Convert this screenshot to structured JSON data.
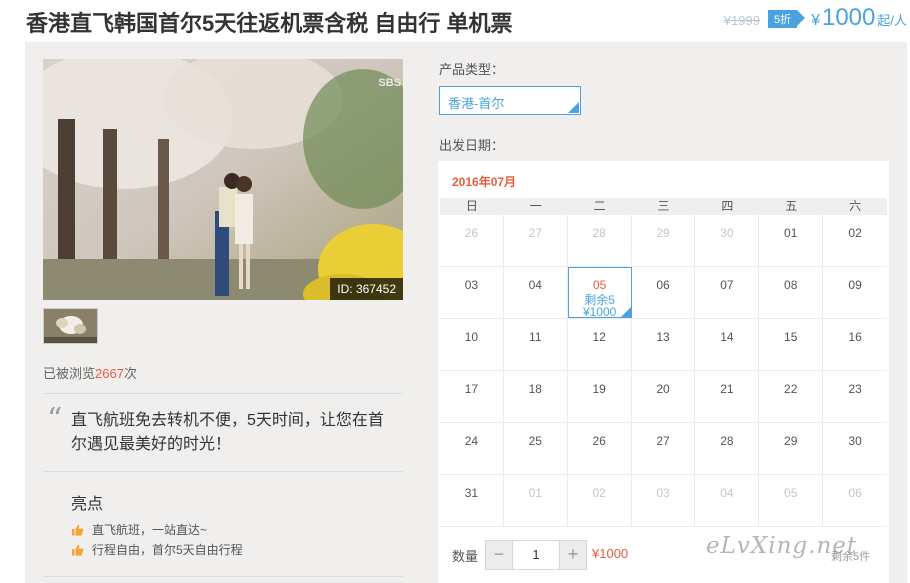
{
  "product": {
    "title": "香港直飞韩国首尔5天往返机票含税 自由行 单机票",
    "old_price": "¥1999",
    "discount": "5折",
    "price_symbol": "¥",
    "price": "1000",
    "price_unit": "起/人"
  },
  "gallery": {
    "photo_id": "ID: 367452",
    "photo_logo": "SBS"
  },
  "views": {
    "prefix": "已被浏览",
    "count": "2667",
    "suffix": "次"
  },
  "quote": "直飞航班免去转机不便，5天时间，让您在首尔遇见最美好的时光！",
  "highlights": {
    "title": "亮点",
    "items": [
      {
        "icon": "thumbs-up-icon",
        "text": "直飞航班，一站直达~"
      },
      {
        "icon": "thumbs-up-icon",
        "text": "行程自由，首尔5天自由行程"
      }
    ]
  },
  "booking": {
    "type_label": "产品类型：",
    "type_value": "香港-首尔",
    "date_label": "出发日期：",
    "month": "2016年07月",
    "weekdays": [
      "日",
      "一",
      "二",
      "三",
      "四",
      "五",
      "六"
    ],
    "weeks": [
      [
        {
          "d": "26",
          "m": true
        },
        {
          "d": "27",
          "m": true
        },
        {
          "d": "28",
          "m": true
        },
        {
          "d": "29",
          "m": true
        },
        {
          "d": "30",
          "m": true
        },
        {
          "d": "01"
        },
        {
          "d": "02"
        }
      ],
      [
        {
          "d": "03"
        },
        {
          "d": "04"
        },
        {
          "d": "05",
          "sel": true,
          "rem": "剩余5",
          "price": "¥1000"
        },
        {
          "d": "06"
        },
        {
          "d": "07"
        },
        {
          "d": "08"
        },
        {
          "d": "09"
        }
      ],
      [
        {
          "d": "10"
        },
        {
          "d": "11"
        },
        {
          "d": "12"
        },
        {
          "d": "13"
        },
        {
          "d": "14"
        },
        {
          "d": "15"
        },
        {
          "d": "16"
        }
      ],
      [
        {
          "d": "17"
        },
        {
          "d": "18"
        },
        {
          "d": "19"
        },
        {
          "d": "20"
        },
        {
          "d": "21"
        },
        {
          "d": "22"
        },
        {
          "d": "23"
        }
      ],
      [
        {
          "d": "24"
        },
        {
          "d": "25"
        },
        {
          "d": "26"
        },
        {
          "d": "27"
        },
        {
          "d": "28"
        },
        {
          "d": "29"
        },
        {
          "d": "30"
        }
      ],
      [
        {
          "d": "31"
        },
        {
          "d": "01",
          "m": true
        },
        {
          "d": "02",
          "m": true
        },
        {
          "d": "03",
          "m": true
        },
        {
          "d": "04",
          "m": true
        },
        {
          "d": "05",
          "m": true
        },
        {
          "d": "06",
          "m": true
        }
      ]
    ],
    "qty_label": "数量",
    "qty_minus": "−",
    "qty_value": "1",
    "qty_plus": "+",
    "qty_price": "¥1000",
    "remaining": "剩余5件"
  },
  "watermark": "eLvXing.net",
  "colors": {
    "accent": "#4aa3e0",
    "price_red": "#e85b3f",
    "panel_bg": "#f0efee"
  }
}
